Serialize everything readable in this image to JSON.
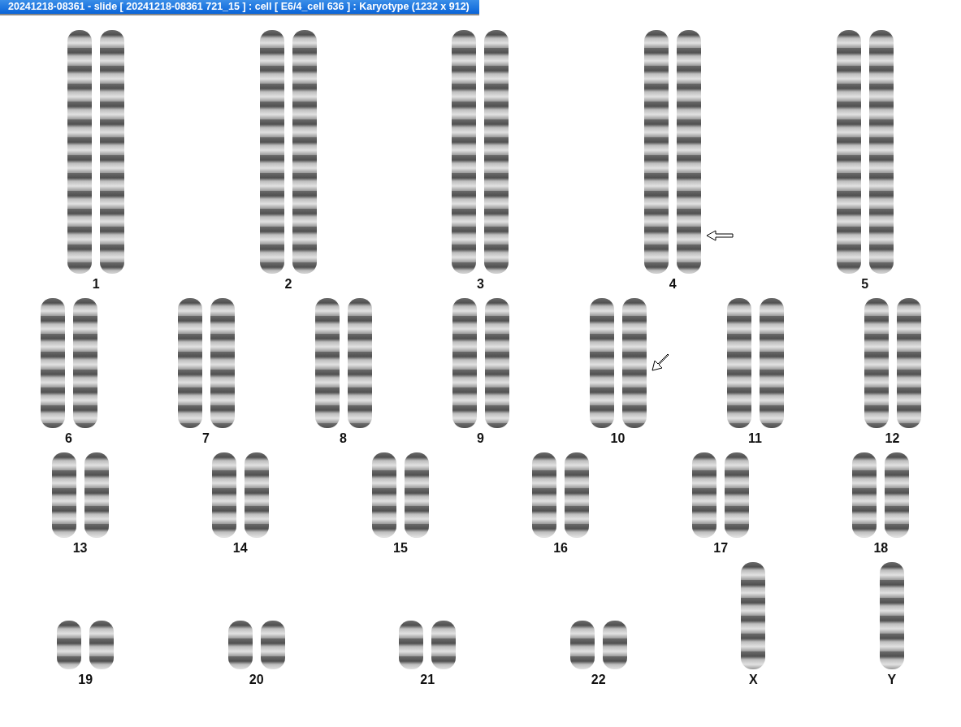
{
  "window": {
    "title": "20241218-08361 - slide [ 20241218-08361 721_15 ] : cell [ E6/4_cell 636 ] : Karyotype  (1232 x 912)"
  },
  "rows": [
    {
      "kind": "large",
      "items": [
        {
          "label": "1",
          "kind": "pair"
        },
        {
          "label": "2",
          "kind": "pair"
        },
        {
          "label": "3",
          "kind": "pair"
        },
        {
          "label": "4",
          "kind": "pair",
          "arrow": {
            "kind": "left"
          }
        },
        {
          "label": "5",
          "kind": "pair"
        }
      ]
    },
    {
      "kind": "medium",
      "items": [
        {
          "label": "6",
          "kind": "pair"
        },
        {
          "label": "7",
          "kind": "pair"
        },
        {
          "label": "8",
          "kind": "pair"
        },
        {
          "label": "9",
          "kind": "pair"
        },
        {
          "label": "10",
          "kind": "pair",
          "arrow": {
            "kind": "diagonal"
          }
        },
        {
          "label": "11",
          "kind": "pair"
        },
        {
          "label": "12",
          "kind": "pair"
        }
      ]
    },
    {
      "kind": "small",
      "items": [
        {
          "label": "13",
          "kind": "pair"
        },
        {
          "label": "14",
          "kind": "pair"
        },
        {
          "label": "15",
          "kind": "pair"
        },
        {
          "label": "16",
          "kind": "pair"
        },
        {
          "label": "17",
          "kind": "pair"
        },
        {
          "label": "18",
          "kind": "pair"
        }
      ]
    },
    {
      "kind": "tiny",
      "items": [
        {
          "label": "19",
          "kind": "pair"
        },
        {
          "label": "20",
          "kind": "pair"
        },
        {
          "label": "21",
          "kind": "pair"
        },
        {
          "label": "22",
          "kind": "pair"
        },
        {
          "label": "X",
          "kind": "single"
        },
        {
          "label": "Y",
          "kind": "single"
        }
      ]
    }
  ]
}
